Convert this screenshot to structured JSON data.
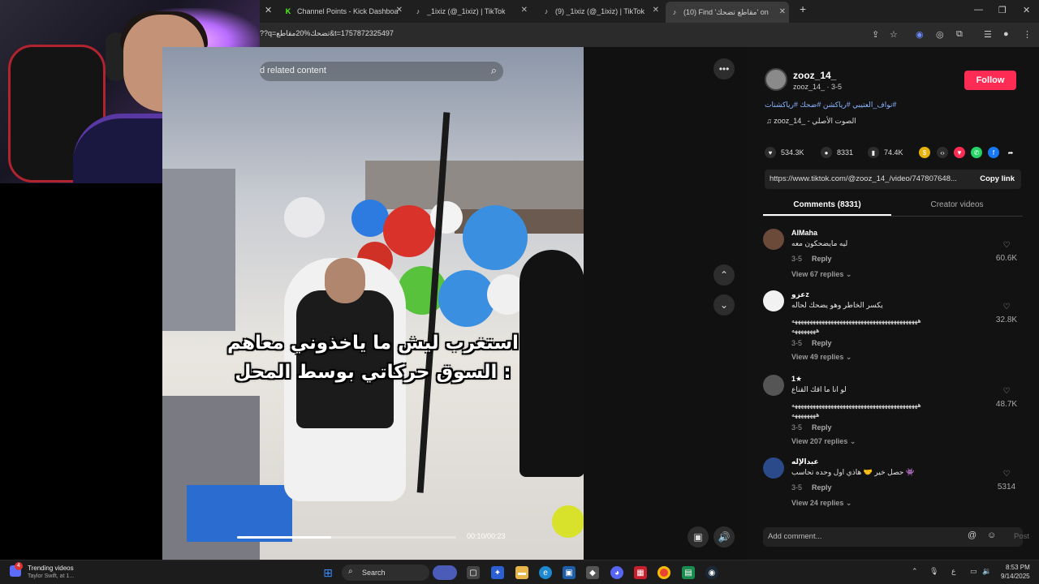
{
  "browser": {
    "tabs": [
      {
        "label": "Channel Points - Kick Dashboa",
        "icon": "kick-icon"
      },
      {
        "label": "_1ixiz (@_1ixiz) | TikTok",
        "icon": "tiktok-icon"
      },
      {
        "label": "(9) _1ixiz (@_1ixiz) | TikTok",
        "icon": "tiktok-icon"
      },
      {
        "label": "(10) Find 'مقاطع تضحك' on",
        "icon": "tiktok-icon"
      }
    ],
    "url": "??q=تضحك%20مقاطع&t=1757872325497"
  },
  "video": {
    "search_placeholder": "d related content",
    "caption_line1": "استغرب ليش ما ياخذوني معاهم",
    "caption_line2": "السوق حركاتي بوسط المحل :",
    "current_time": "00:10",
    "duration": "00:23",
    "time_display": "00:10/00:23",
    "progress": 0.43
  },
  "post": {
    "username": "zooz_14_",
    "subline": "zooz_14_ · 3-5",
    "follow_label": "Follow",
    "hashtags": "#نواف_العتيبي #رياكشن #ضحك #رياكشنات",
    "sound": "zooz_14_ - الصوت الأصلي",
    "likes": "534.3K",
    "comments_count": "8331",
    "saves": "74.4K",
    "link_url": "https://www.tiktok.com/@zooz_14_/video/747807648...",
    "copy_link_label": "Copy link"
  },
  "panel_tabs": {
    "comments": "Comments (8331)",
    "creator": "Creator videos"
  },
  "comments": [
    {
      "name": "AlMaha",
      "text": "ليه مايضحكون معه",
      "text2": "",
      "date": "3-5",
      "reply": "Reply",
      "views": "View 67 replies",
      "likes": "60.6K"
    },
    {
      "name": "عزوz",
      "text": "يكسر الخاطر وهو يضحك لحاله",
      "text2": "ههههههههههههههههههههههههههههههههههههههههههه",
      "text3": "ههههههههه",
      "date": "3-5",
      "reply": "Reply",
      "views": "View 49 replies",
      "likes": "32.8K"
    },
    {
      "name": "1★",
      "text": "لو انا ما اقك القناع",
      "text2": "ههههههههههههههههههههههههههههههههههههههههههه",
      "text3": "ههههههههه",
      "date": "3-5",
      "reply": "Reply",
      "views": "View 207 replies",
      "likes": "48.7K"
    },
    {
      "name": "عبدالإله",
      "text": "حصل خير 🤝 هاذي اول وحده تحاسب 👾",
      "text2": "",
      "date": "3-5",
      "reply": "Reply",
      "views": "View 24 replies",
      "likes": "5314"
    }
  ],
  "add_comment": {
    "placeholder": "Add comment...",
    "post_label": "Post"
  },
  "taskbar": {
    "widget_title": "Trending videos",
    "widget_sub": "Taylor Swift, at 1...",
    "badge": "4",
    "search_label": "Search",
    "time": "8:53 PM",
    "date": "9/14/2025"
  }
}
